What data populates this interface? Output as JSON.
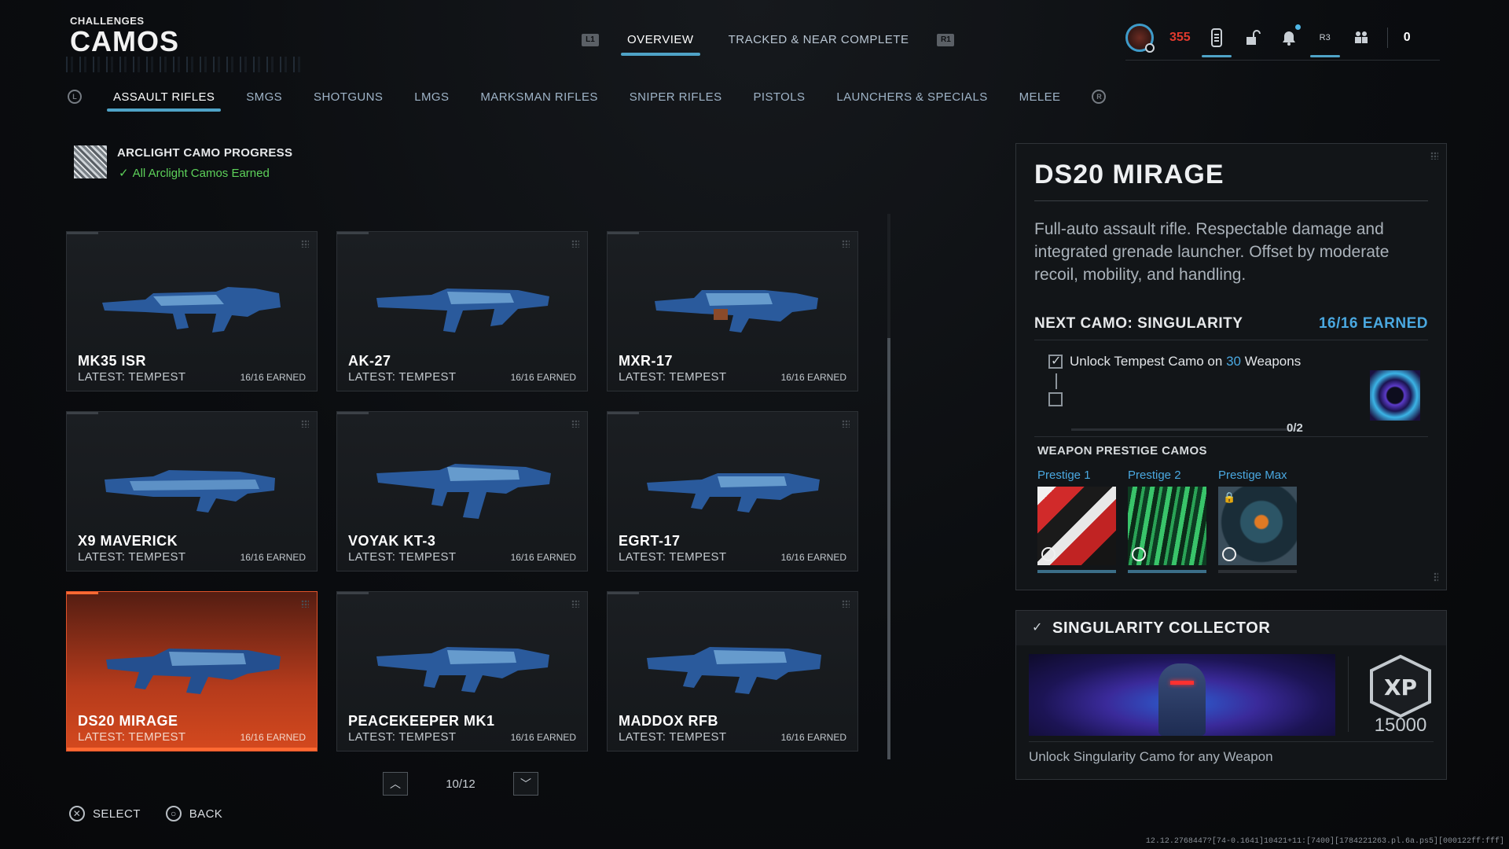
{
  "header": {
    "section": "CHALLENGES",
    "title": "CAMOS"
  },
  "top_tabs": {
    "left_glyph": "L1",
    "right_glyph": "R1",
    "items": [
      {
        "label": "OVERVIEW",
        "active": true
      },
      {
        "label": "TRACKED & NEAR COMPLETE",
        "active": false
      }
    ]
  },
  "status": {
    "rank": "355",
    "r3_label": "R3",
    "count": "0"
  },
  "categories": {
    "left_glyph": "L",
    "right_glyph": "R",
    "items": [
      {
        "label": "ASSAULT RIFLES",
        "active": true
      },
      {
        "label": "SMGS"
      },
      {
        "label": "SHOTGUNS"
      },
      {
        "label": "LMGS"
      },
      {
        "label": "MARKSMAN RIFLES"
      },
      {
        "label": "SNIPER RIFLES"
      },
      {
        "label": "PISTOLS"
      },
      {
        "label": "LAUNCHERS & SPECIALS"
      },
      {
        "label": "MELEE"
      }
    ]
  },
  "arclight": {
    "title": "ARCLIGHT CAMO PROGRESS",
    "status": "All Arclight Camos Earned"
  },
  "weapons": [
    {
      "name": "MK35 ISR",
      "latest": "LATEST: TEMPEST",
      "earned": "16/16 EARNED"
    },
    {
      "name": "AK-27",
      "latest": "LATEST: TEMPEST",
      "earned": "16/16 EARNED"
    },
    {
      "name": "MXR-17",
      "latest": "LATEST: TEMPEST",
      "earned": "16/16 EARNED"
    },
    {
      "name": "X9 MAVERICK",
      "latest": "LATEST: TEMPEST",
      "earned": "16/16 EARNED"
    },
    {
      "name": "VOYAK KT-3",
      "latest": "LATEST: TEMPEST",
      "earned": "16/16 EARNED"
    },
    {
      "name": "EGRT-17",
      "latest": "LATEST: TEMPEST",
      "earned": "16/16 EARNED"
    },
    {
      "name": "DS20 MIRAGE",
      "latest": "LATEST: TEMPEST",
      "earned": "16/16 EARNED",
      "selected": true
    },
    {
      "name": "PEACEKEEPER MK1",
      "latest": "LATEST: TEMPEST",
      "earned": "16/16 EARNED"
    },
    {
      "name": "MADDOX RFB",
      "latest": "LATEST: TEMPEST",
      "earned": "16/16 EARNED"
    }
  ],
  "pager": {
    "text": "10/12"
  },
  "footer": {
    "select_label": "SELECT",
    "back_label": "BACK"
  },
  "build_info": "12.12.2768447?[74-0.1641]10421+11:[7400][1784221263.pl.6a.ps5][000122ff:fff]",
  "detail": {
    "title": "DS20 MIRAGE",
    "description": "Full-auto assault rifle. Respectable damage and integrated grenade launcher. Offset by moderate recoil, mobility, and handling.",
    "next_camo": "NEXT CAMO: SINGULARITY",
    "earned": "16/16 EARNED",
    "requirement_prefix": "Unlock Tempest Camo on ",
    "requirement_count": "30",
    "requirement_suffix": " Weapons",
    "progress": "0/2",
    "prestige_header": "WEAPON PRESTIGE CAMOS",
    "prestige": [
      {
        "label": "Prestige 1"
      },
      {
        "label": "Prestige 2"
      },
      {
        "label": "Prestige Max"
      }
    ]
  },
  "collector": {
    "title": "SINGULARITY COLLECTOR",
    "xp_label": "XP",
    "xp": "15000",
    "description": "Unlock Singularity Camo for any Weapon"
  },
  "colors": {
    "accent": "#4fa3c7",
    "selected": "#d4491e",
    "success": "#5dd15a",
    "rank": "#e23a2e"
  }
}
